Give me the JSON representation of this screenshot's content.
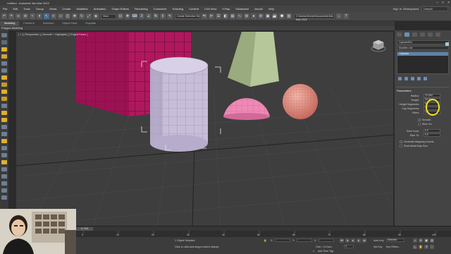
{
  "window": {
    "title": "Untitled - Autodesk 3ds Max 2022"
  },
  "menu": {
    "items": [
      "File",
      "Edit",
      "Tools",
      "Group",
      "Views",
      "Create",
      "Modifiers",
      "Animation",
      "Graph Editors",
      "Rendering",
      "Customize",
      "Scripting",
      "Content",
      "Civil View",
      "V-Ray",
      "Substance",
      "Arnold",
      "Help"
    ],
    "signin": "Sign In",
    "workspaces_label": "Workspaces:",
    "workspace": "Default"
  },
  "toolbar": {
    "view_dropdown": "View",
    "selection_set": "Create Selection Se",
    "project_path": "C:\\Users\\Xtreme\\Documents\\3ds Max 2022"
  },
  "ribbon": {
    "tabs": [
      "Modeling",
      "Freeform",
      "Selection",
      "Object Paint",
      "Populate"
    ],
    "active": "Modeling",
    "subtitle": "Polygon Modeling"
  },
  "viewport": {
    "label": "[ + ] [ Perspective ] [ Smooth + Highlights ] [ Edged Faces ]",
    "viewcube": "viewcube"
  },
  "command_panel": {
    "object_name": "Cylinder001",
    "object_color": "#a4c8e0",
    "modifier_list": "Modifier List",
    "stack_items": [
      "Cylinder"
    ],
    "rollout": "Parameters",
    "params": [
      {
        "label": "Radius:",
        "value": "20.0cm"
      },
      {
        "label": "Height:",
        "value": "50.0cm"
      },
      {
        "label": "Height Segments:",
        "value": "5"
      },
      {
        "label": "Cap Segments:",
        "value": "1"
      },
      {
        "label": "Sides:",
        "value": "18"
      }
    ],
    "checks": [
      {
        "label": "Smooth",
        "checked": true
      },
      {
        "label": "Slice On",
        "checked": false
      }
    ],
    "slice_params": [
      {
        "label": "Slice From:",
        "value": "0.0"
      },
      {
        "label": "Slice To:",
        "value": "0.0"
      }
    ],
    "mapping": [
      {
        "label": "Generate Mapping Coords.",
        "checked": true
      },
      {
        "label": "Real-World Map Size",
        "checked": false
      }
    ]
  },
  "timeline": {
    "frame": "0 / 100",
    "ticks": [
      "0",
      "10",
      "20",
      "30",
      "40",
      "50",
      "60",
      "70",
      "80",
      "90",
      "100"
    ]
  },
  "status": {
    "selected": "1 Object Selected",
    "hint": "Click or click-and-drag to select objects",
    "grid": "Grid = 10.0cm",
    "add_time_tag": "Add Time Tag",
    "auto_key": "Auto Key",
    "selected_btn": "Selected",
    "set_key": "Set Key",
    "key_filters": "Key Filters...",
    "frame_field": "0",
    "coords": {
      "x": "X:",
      "y": "Y:",
      "z": "Z:"
    }
  },
  "colors": {
    "box": "#b0185e",
    "cylinder": "#c7bdd8",
    "pyramid": "#b6c79a",
    "hemisphere": "#ef88b4",
    "sphere": "#e39a8c",
    "highlight": "#f0e21a",
    "accent": "#5e82aa"
  }
}
